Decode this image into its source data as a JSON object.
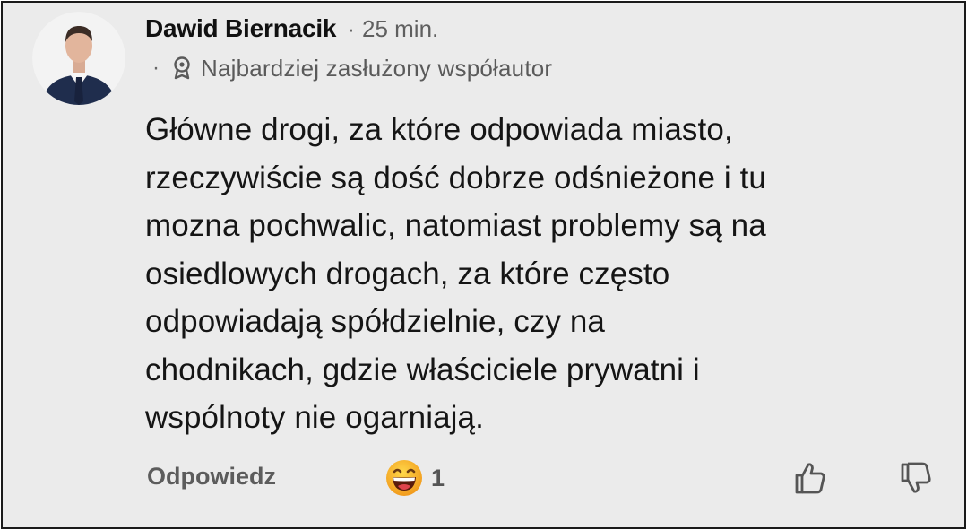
{
  "comment": {
    "author": "Dawid Biernacik",
    "separator": "·",
    "time": "25 min.",
    "badge": {
      "dot": "·",
      "icon": "award-ribbon-icon",
      "label": "Najbardziej zasłużony współautor"
    },
    "text": "Główne drogi, za które odpowiada miasto,\nrzeczywiście są dość dobrze odśnieżone i tu\nmozna pochwalic, natomiast problemy są na\nosiedlowych drogach, za które często\nodpowiadają spółdzielnie, czy na\nchodnikach, gdzie właściciele prywatni i\nwspólnoty nie ogarniają."
  },
  "actions": {
    "reply_label": "Odpowiedz",
    "reaction": {
      "emoji": "grinning-face-icon",
      "count": "1"
    },
    "like_icon": "thumbs-up-icon",
    "dislike_icon": "thumbs-down-icon"
  },
  "colors": {
    "background": "#ebebeb",
    "text_primary": "#151515",
    "text_secondary": "#5c5c5c",
    "emoji_yellow": "#f7b32b"
  }
}
